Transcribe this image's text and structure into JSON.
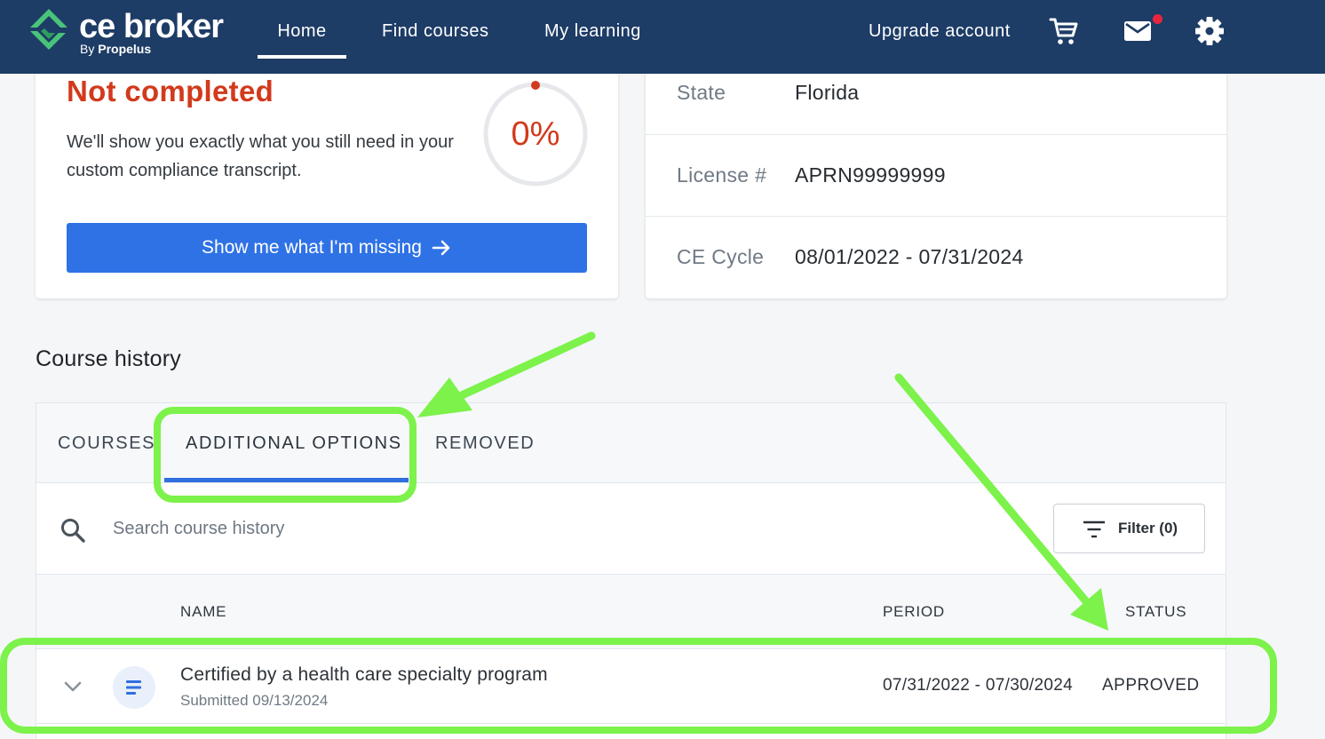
{
  "brand": {
    "name": "ce broker",
    "by_prefix": "By",
    "by_company": "Propelus",
    "primary_color": "#1d3c66",
    "mark_color": "#49c37a"
  },
  "nav": {
    "home": "Home",
    "find_courses": "Find courses",
    "my_learning": "My learning",
    "upgrade": "Upgrade account",
    "icons": [
      "cart-icon",
      "mail-icon",
      "gear-icon"
    ],
    "mail_has_unread": true
  },
  "compliance": {
    "status": "Not completed",
    "description": "We'll show you exactly what you still need in your custom compliance transcript.",
    "percent_text": "0%",
    "percent": 0,
    "button_label": "Show me what I'm missing",
    "accent_color": "#d23a1c"
  },
  "license": {
    "rows": [
      {
        "label": "State",
        "value": "Florida"
      },
      {
        "label": "License #",
        "value": "APRN99999999"
      },
      {
        "label": "CE Cycle",
        "value": "08/01/2022 - 07/31/2024"
      }
    ]
  },
  "history": {
    "title": "Course history",
    "tabs": [
      {
        "label": "COURSES",
        "active": false
      },
      {
        "label": "ADDITIONAL OPTIONS",
        "active": true
      },
      {
        "label": "REMOVED",
        "active": false
      }
    ],
    "search_placeholder": "Search course history",
    "filter_label": "Filter (0)",
    "columns": {
      "name": "NAME",
      "period": "PERIOD",
      "status": "STATUS"
    },
    "rows": [
      {
        "name": "Certified by a health care specialty program",
        "submitted": "Submitted 09/13/2024",
        "period": "07/31/2022 - 07/30/2024",
        "status": "APPROVED"
      }
    ]
  },
  "annotations": {
    "highlight_color": "#7cf24a"
  }
}
